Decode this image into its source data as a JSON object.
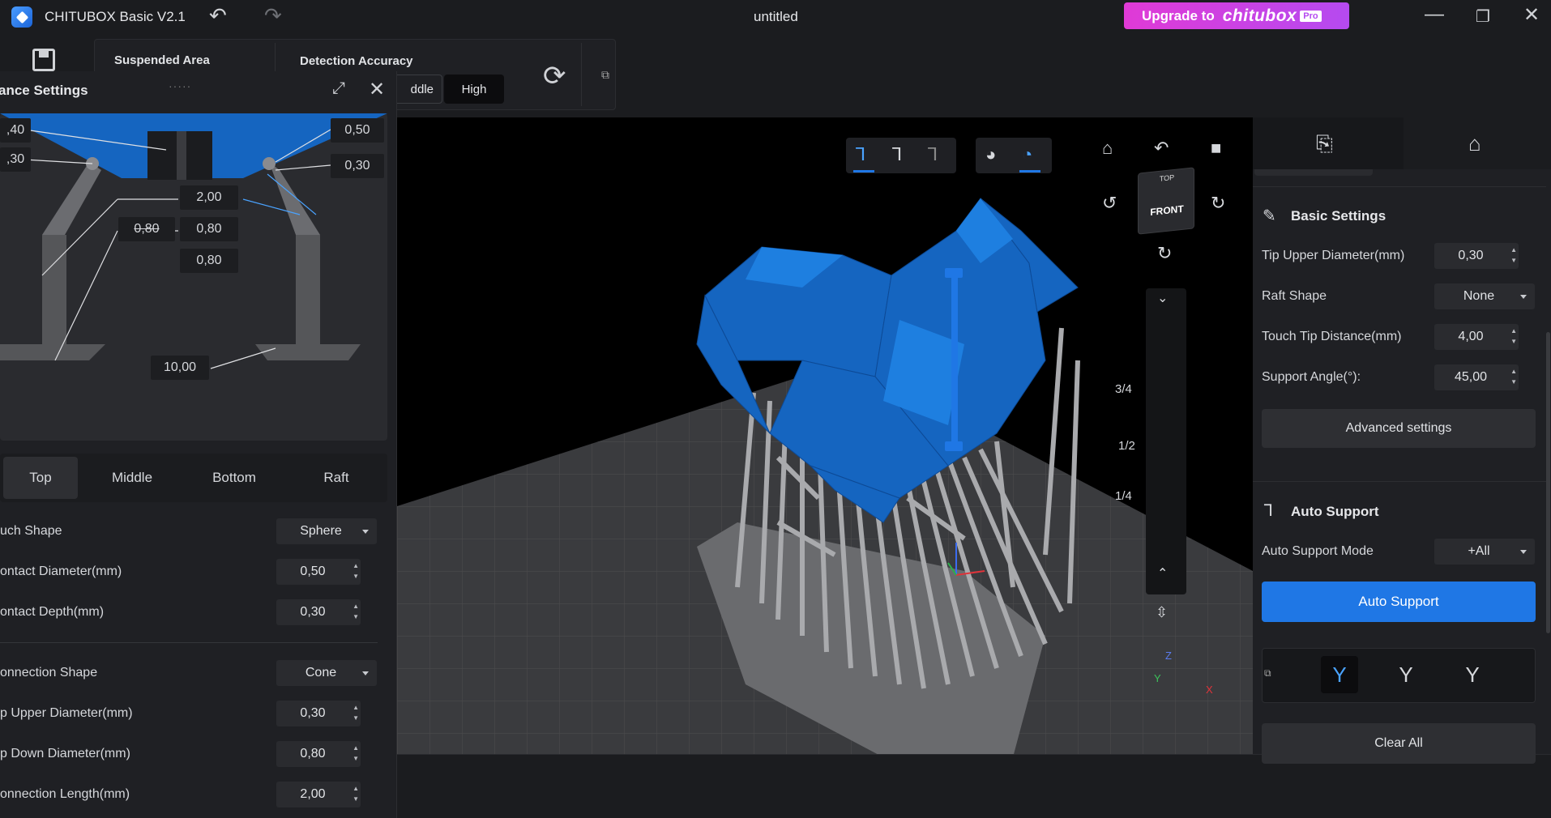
{
  "app": {
    "title": "CHITUBOX Basic V2.1",
    "document": "untitled",
    "upgrade_text": "Upgrade to",
    "upgrade_brand": "chitubox",
    "upgrade_badge": "Pro"
  },
  "toolbar": {
    "suspended_area": "Suspended Area",
    "detection_accuracy": "Detection Accuracy",
    "middle": "ddle",
    "high": "High"
  },
  "advanced": {
    "title": "ance Settings",
    "diagram_values": {
      "tl1": ",40",
      "tl2": ",30",
      "tr1": "0,50",
      "tr2": "0,30",
      "c1": "2,00",
      "c2": "0,80",
      "c3": "0,80",
      "c4": "0,80",
      "c5": "10,00"
    },
    "tabs": [
      "Top",
      "Middle",
      "Bottom",
      "Raft"
    ],
    "rows": [
      {
        "label": "uch Shape",
        "value": "Sphere",
        "kind": "select"
      },
      {
        "label": "ontact Diameter(mm)",
        "value": "0,50",
        "kind": "field"
      },
      {
        "label": "ontact Depth(mm)",
        "value": "0,30",
        "kind": "field"
      },
      {
        "label": "onnection Shape",
        "value": "Cone",
        "kind": "select"
      },
      {
        "label": "p Upper Diameter(mm)",
        "value": "0,30",
        "kind": "field"
      },
      {
        "label": "p Down Diameter(mm)",
        "value": "0,80",
        "kind": "field"
      },
      {
        "label": "onnection Length(mm)",
        "value": "2,00",
        "kind": "field"
      }
    ]
  },
  "viewport": {
    "slider_marks": [
      "3/4",
      "1/2",
      "1/4"
    ],
    "cube_front": "FRONT",
    "cube_top": "TOP",
    "axis_x": "X",
    "axis_y": "Y",
    "axis_z": "Z"
  },
  "basic": {
    "title": "Basic Settings",
    "rows": [
      {
        "label": "Tip Upper Diameter(mm)",
        "value": "0,30",
        "kind": "field"
      },
      {
        "label": "Raft Shape",
        "value": "None",
        "kind": "select"
      },
      {
        "label": "Touch Tip Distance(mm)",
        "value": "4,00",
        "kind": "field"
      },
      {
        "label": "Support Angle(°):",
        "value": "45,00",
        "kind": "field"
      }
    ],
    "advanced_button": "Advanced settings"
  },
  "auto": {
    "title": "Auto Support",
    "mode_label": "Auto Support Mode",
    "mode_value": "+All",
    "button": "Auto Support",
    "clear": "Clear All"
  },
  "colors": {
    "accent": "#1f77e5",
    "model": "#1565c0",
    "upgrade": "#e03ad6"
  }
}
